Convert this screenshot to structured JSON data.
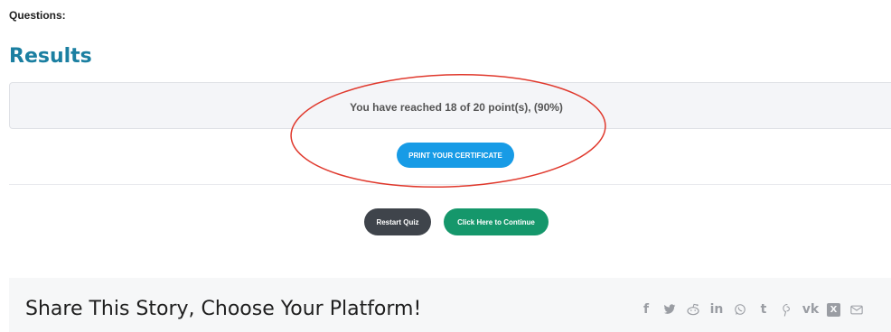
{
  "quiz": {
    "questions_label": "Questions:",
    "results_title": "Results",
    "score_text": "You have reached 18 of 20 point(s), (90%)",
    "score": {
      "points": 18,
      "total": 20,
      "percent": 90
    },
    "certificate_button": "PRINT YOUR CERTIFICATE",
    "restart_button": "Restart Quiz",
    "continue_button": "Click Here to Continue"
  },
  "share": {
    "title": "Share This Story, Choose Your Platform!",
    "icons": [
      {
        "name": "facebook-icon",
        "glyph": "f"
      },
      {
        "name": "twitter-icon",
        "glyph": "🐦"
      },
      {
        "name": "reddit-icon",
        "glyph": "◎"
      },
      {
        "name": "linkedin-icon",
        "glyph": "in"
      },
      {
        "name": "whatsapp-icon",
        "glyph": "✆"
      },
      {
        "name": "tumblr-icon",
        "glyph": "t"
      },
      {
        "name": "pinterest-icon",
        "glyph": "℗"
      },
      {
        "name": "vk-icon",
        "glyph": "vk"
      },
      {
        "name": "xing-icon",
        "glyph": "X"
      },
      {
        "name": "email-icon",
        "glyph": "✉"
      }
    ]
  },
  "colors": {
    "title": "#1b7fa1",
    "certificate_button": "#179be6",
    "restart_button": "#3f444b",
    "continue_button": "#15976b",
    "annotation_ellipse": "#e0392d"
  }
}
